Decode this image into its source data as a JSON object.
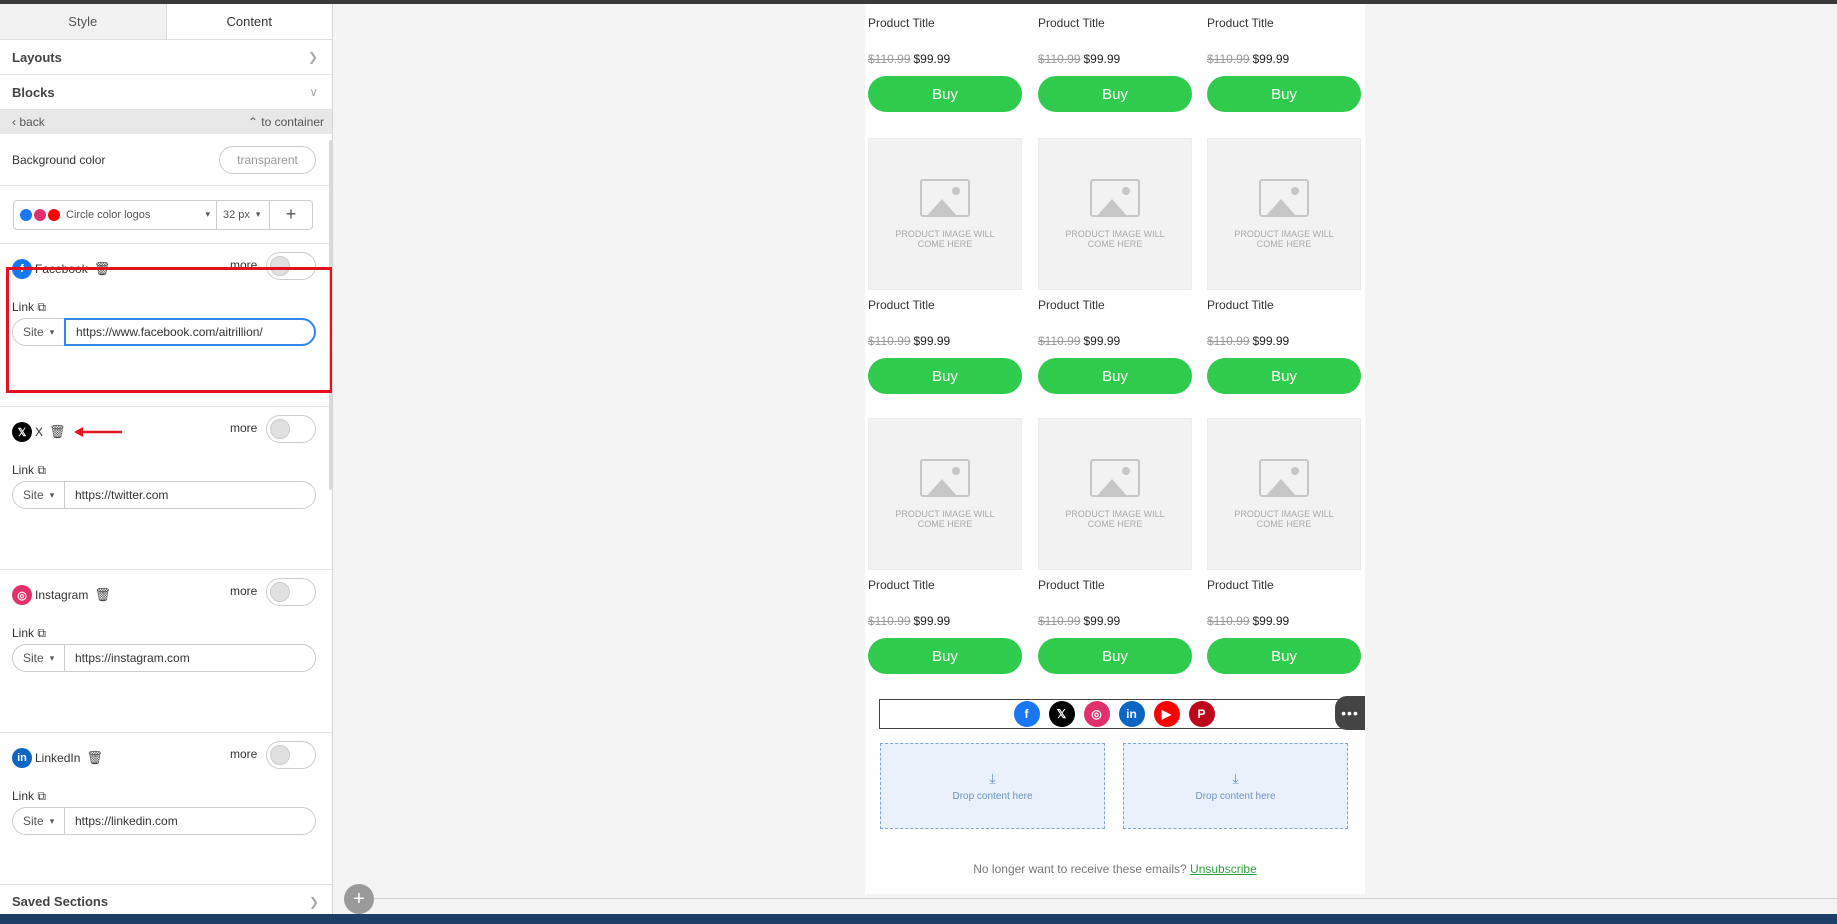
{
  "sidebar": {
    "tabs": [
      {
        "label": "Style"
      },
      {
        "label": "Content"
      }
    ],
    "layouts_label": "Layouts",
    "blocks_label": "Blocks",
    "back_label": "back",
    "to_container_label": "to container",
    "background_color_label": "Background color",
    "background_color_value": "transparent",
    "logo_style": "Circle color logos",
    "icon_size": "32 px",
    "add_label": "+",
    "more_label": "more",
    "link_label": "Link",
    "site_label": "Site",
    "socials": [
      {
        "name": "Facebook",
        "url": "https://www.facebook.com/aitrillion/",
        "color": "#1877f2",
        "glyph": "f"
      },
      {
        "name": "X",
        "url": "https://twitter.com",
        "color": "#000000",
        "glyph": "𝕏"
      },
      {
        "name": "Instagram",
        "url": "https://instagram.com",
        "color": "#e1306c",
        "glyph": "◎"
      },
      {
        "name": "LinkedIn",
        "url": "https://linkedin.com",
        "color": "#0a66c2",
        "glyph": "in"
      }
    ],
    "saved_sections_label": "Saved Sections"
  },
  "email": {
    "product_title": "Product Title",
    "old_price": "$110.99",
    "new_price": "$99.99",
    "buy_label": "Buy",
    "placeholder_text": "PRODUCT IMAGE WILL COME HERE",
    "social_icons": [
      {
        "name": "facebook",
        "color": "#1877f2",
        "glyph": "f"
      },
      {
        "name": "x",
        "color": "#000000",
        "glyph": "𝕏"
      },
      {
        "name": "instagram",
        "color": "#e1306c",
        "glyph": "◎"
      },
      {
        "name": "linkedin",
        "color": "#0a66c2",
        "glyph": "in"
      },
      {
        "name": "youtube",
        "color": "#ff0000",
        "glyph": "▶"
      },
      {
        "name": "pinterest",
        "color": "#bd081c",
        "glyph": "P"
      }
    ],
    "drop_label": "Drop content here",
    "unsubscribe_prefix": "No longer want to receive these emails?",
    "unsubscribe_link": "Unsubscribe"
  },
  "colors": {
    "buy": "#2fcb4d",
    "highlight": "#e3121f",
    "focus": "#2f86e6"
  }
}
